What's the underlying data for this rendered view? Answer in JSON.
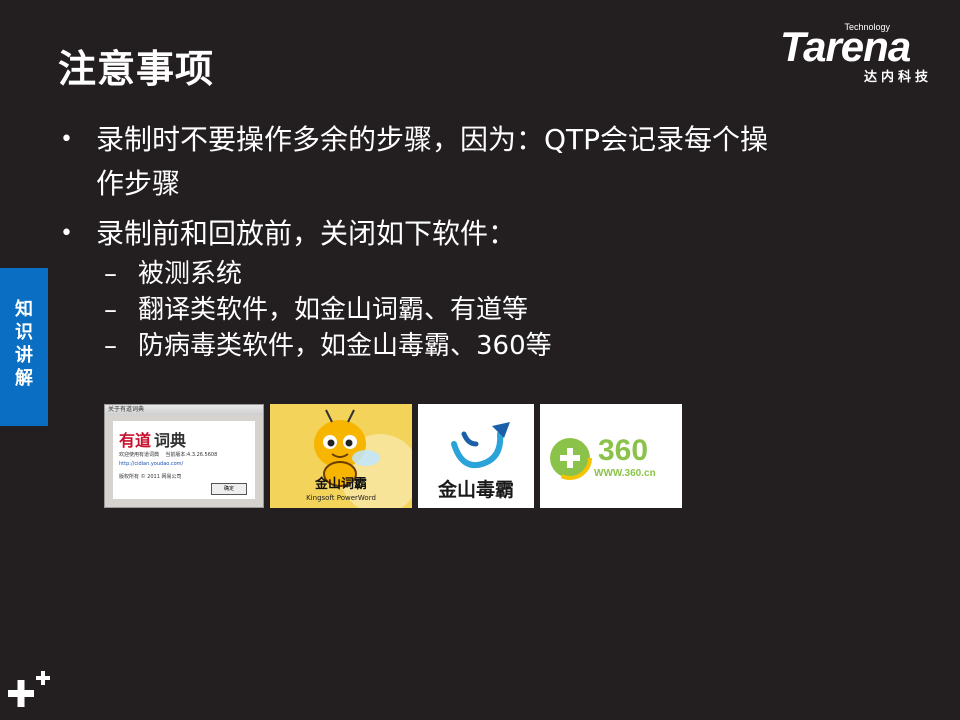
{
  "slide": {
    "title": "注意事项",
    "logo": {
      "small": "Technology",
      "main": "Tarena",
      "cn": "达内科技"
    },
    "side_tab": {
      "text": "知识讲解",
      "color": "#0a6fc2"
    },
    "bullets": [
      {
        "text": "录制时不要操作多余的步骤，因为：QTP会记录每个操",
        "cont": "作步骤"
      },
      {
        "text": "录制前和回放前，关闭如下软件："
      }
    ],
    "sub_bullets": [
      "被测系统",
      "翻译类软件，如金山词霸、有道等",
      "防病毒类软件，如金山毒霸、360等"
    ],
    "bullet_marker": "•",
    "sub_marker": "–",
    "thumbnails": {
      "youdao": {
        "window_title": "关于有道词典",
        "logo_red": "有道",
        "logo_black": "词典",
        "welcome": "欢迎使用有道词典",
        "version": "当前版本:4.3.26.5608",
        "url": "http://cidian.youdao.com/",
        "copyright": "版权所有 © 2011 网易公司",
        "ok": "确定"
      },
      "kingsoft_ciba": {
        "brand": "金山词霸",
        "sub": "Kingsoft PowerWord"
      },
      "kingsoft_duba": {
        "brand": "金山毒霸"
      },
      "q360": {
        "number": "360",
        "url": "WWW.360.cn"
      }
    },
    "colors": {
      "background": "#231f20",
      "text": "#ffffff",
      "accent_blue": "#0a6fc2"
    }
  }
}
